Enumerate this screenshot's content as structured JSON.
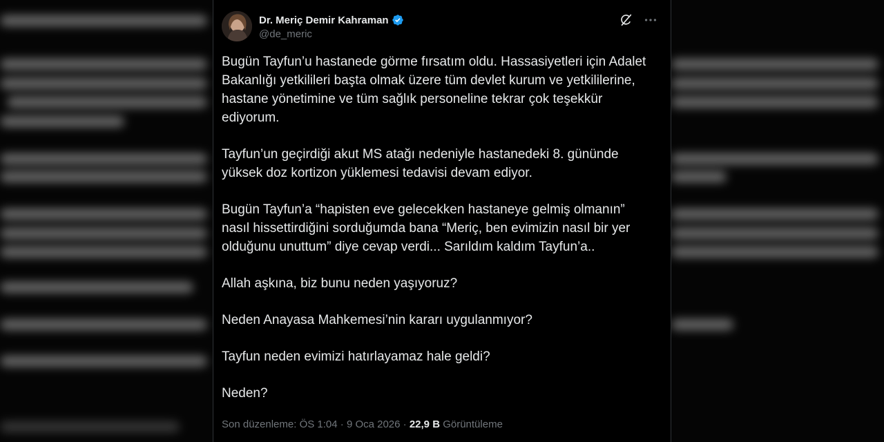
{
  "author": {
    "display_name": "Dr. Meriç Demir Kahraman",
    "handle": "@de_meric",
    "verified": true,
    "verified_color": "#1d9bf0"
  },
  "icons": {
    "verified": "verified-badge-icon",
    "grok": "grok-icon",
    "more": "more-icon"
  },
  "tweet": {
    "paragraphs": [
      "Bugün Tayfun’u hastanede görme fırsatım oldu. Hassasiyetleri için Adalet Bakanlığı yetkilileri başta olmak üzere tüm devlet kurum ve yetkililerine, hastane yönetimine ve tüm sağlık personeline tekrar çok teşekkür ediyorum.",
      "Tayfun’un geçirdiği akut MS atağı nedeniyle hastanedeki 8. gününde yüksek doz kortizon yüklemesi tedavisi devam ediyor.",
      "Bugün Tayfun’a “hapisten eve gelecekken hastaneye gelmiş olmanın” nasıl hissettirdiğini sorduğumda bana “Meriç, ben evimizin nasıl bir yer olduğunu unuttum” diye cevap verdi... Sarıldım kaldım Tayfun’a..",
      "Allah aşkına, biz bunu neden yaşıyoruz?",
      "Neden Anayasa Mahkemesi’nin kararı uygulanmıyor?",
      "Tayfun neden evimizi hatırlayamaz hale geldi?",
      "Neden?"
    ]
  },
  "meta": {
    "edited_prefix": "Son düzenleme: ÖS 1:04 · 9 Oca 2026 · ",
    "views_count": "22,9 B",
    "views_label": " Görüntüleme"
  }
}
